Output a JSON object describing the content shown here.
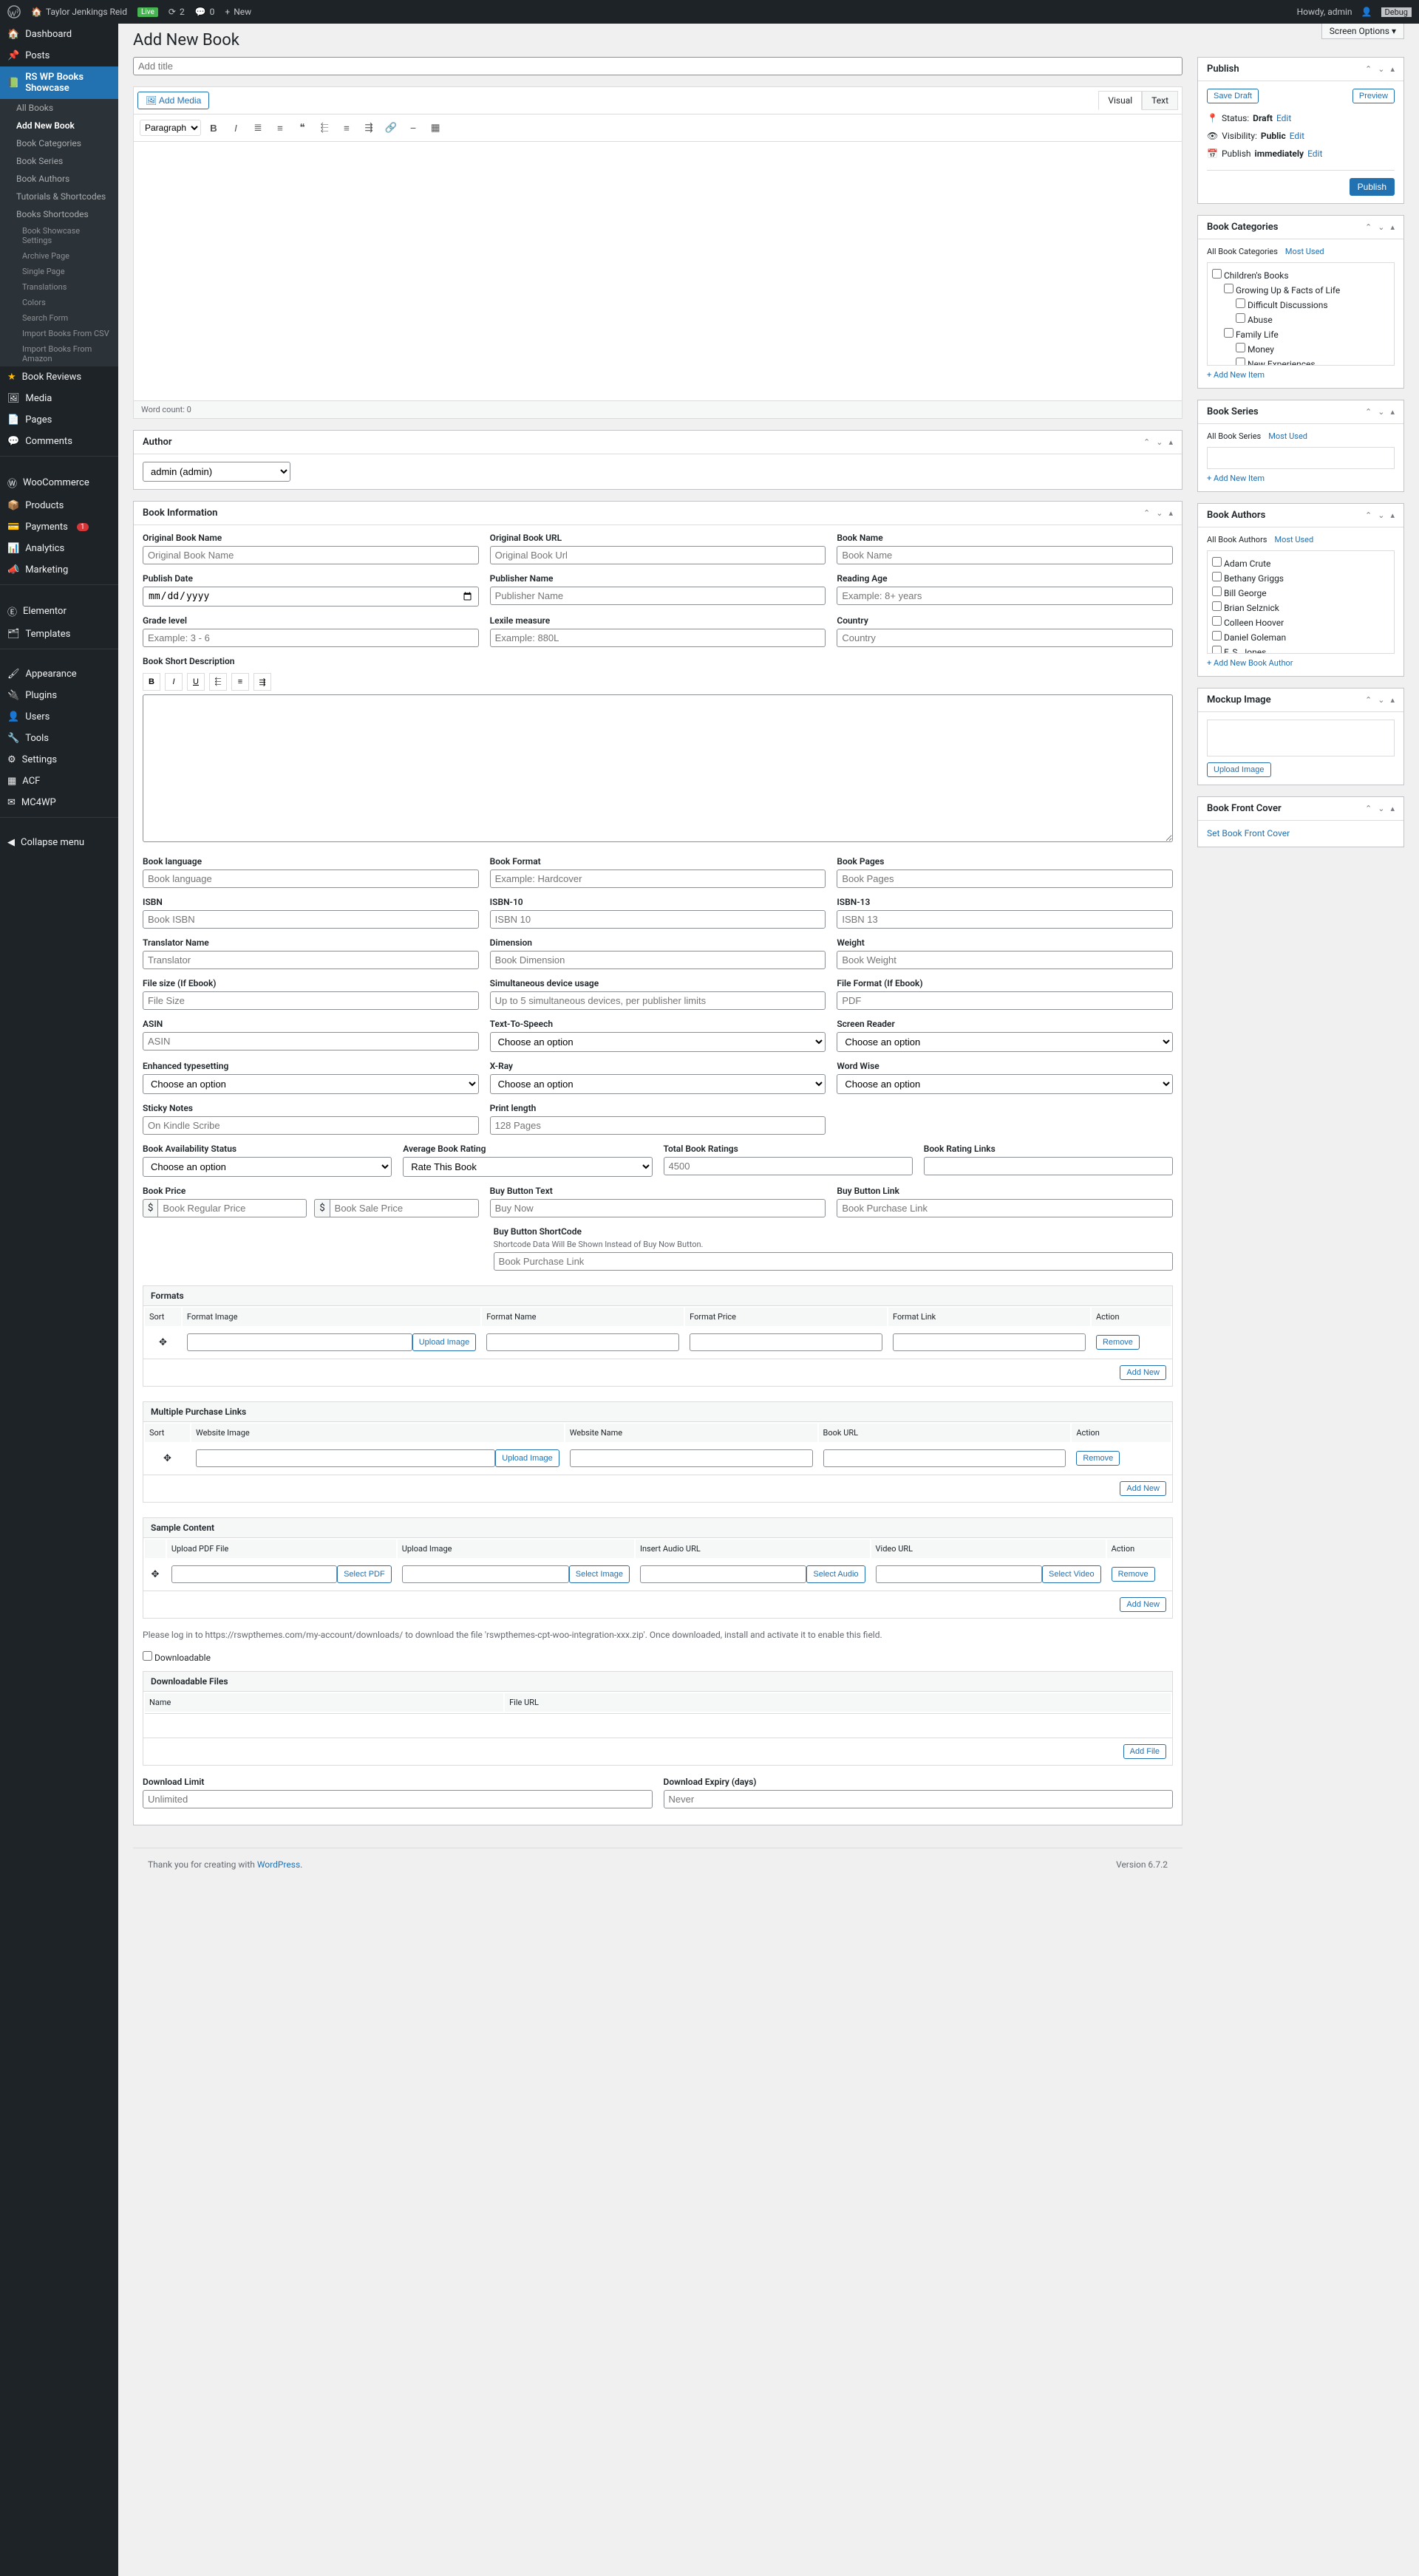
{
  "adminbar": {
    "site": "Taylor Jenkings Reid",
    "live": "Live",
    "updates": "2",
    "comments": "0",
    "new": "New",
    "howdy": "Howdy, admin",
    "debug": "Debug"
  },
  "sidebar": {
    "dashboard": "Dashboard",
    "posts": "Posts",
    "rswp": "RS WP Books Showcase",
    "sub": {
      "all": "All Books",
      "add": "Add New Book",
      "cats": "Book Categories",
      "series": "Book Series",
      "authors": "Book Authors",
      "tuts": "Tutorials & Shortcodes",
      "shortcodes": "Books Shortcodes"
    },
    "subsub": {
      "bss": "Book Showcase Settings",
      "archive": "Archive Page",
      "single": "Single Page",
      "trans": "Translations",
      "colors": "Colors",
      "search": "Search Form",
      "import": "Import Books From CSV",
      "amazon": "Import Books From Amazon"
    },
    "reviews": "Book Reviews",
    "media": "Media",
    "pages": "Pages",
    "comments": "Comments",
    "woo": "WooCommerce",
    "products": "Products",
    "payments": "Payments",
    "payments_badge": "1",
    "analytics": "Analytics",
    "marketing": "Marketing",
    "elementor": "Elementor",
    "templates": "Templates",
    "appearance": "Appearance",
    "plugins": "Plugins",
    "users": "Users",
    "tools": "Tools",
    "settings": "Settings",
    "acf": "ACF",
    "mc4wp": "MC4WP",
    "collapse": "Collapse menu"
  },
  "page": {
    "title": "Add New Book",
    "screen_options": "Screen Options",
    "title_placeholder": "Add title"
  },
  "editor": {
    "add_media": "Add Media",
    "visual": "Visual",
    "text": "Text",
    "paragraph": "Paragraph",
    "wordcount": "Word count: 0"
  },
  "author": {
    "heading": "Author",
    "selected": "admin (admin)"
  },
  "info": {
    "heading": "Book Information",
    "orig_name": {
      "l": "Original Book Name",
      "p": "Original Book Name"
    },
    "orig_url": {
      "l": "Original Book URL",
      "p": "Original Book Url"
    },
    "book_name": {
      "l": "Book Name",
      "p": "Book Name"
    },
    "pub_date": {
      "l": "Publish Date",
      "p": "mm / dd / yyyy"
    },
    "pub_name": {
      "l": "Publisher Name",
      "p": "Publisher Name"
    },
    "reading_age": {
      "l": "Reading Age",
      "p": "Example: 8+ years"
    },
    "grade": {
      "l": "Grade level",
      "p": "Example: 3 - 6"
    },
    "lexile": {
      "l": "Lexile measure",
      "p": "Example: 880L"
    },
    "country": {
      "l": "Country",
      "p": "Country"
    },
    "short_desc": "Book Short Description",
    "lang": {
      "l": "Book language",
      "p": "Book language"
    },
    "format": {
      "l": "Book Format",
      "p": "Example: Hardcover"
    },
    "pages": {
      "l": "Book Pages",
      "p": "Book Pages"
    },
    "isbn": {
      "l": "ISBN",
      "p": "Book ISBN"
    },
    "isbn10": {
      "l": "ISBN-10",
      "p": "ISBN 10"
    },
    "isbn13": {
      "l": "ISBN-13",
      "p": "ISBN 13"
    },
    "translator": {
      "l": "Translator Name",
      "p": "Translator"
    },
    "dimension": {
      "l": "Dimension",
      "p": "Book Dimension"
    },
    "weight": {
      "l": "Weight",
      "p": "Book Weight"
    },
    "filesize": {
      "l": "File size (If Ebook)",
      "p": "File Size"
    },
    "simul": {
      "l": "Simultaneous device usage",
      "p": "Up to 5 simultaneous devices, per publisher limits"
    },
    "fileformat": {
      "l": "File Format (If Ebook)",
      "p": "PDF"
    },
    "asin": {
      "l": "ASIN",
      "p": "ASIN"
    },
    "tts": {
      "l": "Text-To-Speech",
      "p": "Choose an option"
    },
    "screenreader": {
      "l": "Screen Reader",
      "p": "Choose an option"
    },
    "enhanced": {
      "l": "Enhanced typesetting",
      "p": "Choose an option"
    },
    "xray": {
      "l": "X-Ray",
      "p": "Choose an option"
    },
    "wordwise": {
      "l": "Word Wise",
      "p": "Choose an option"
    },
    "sticky": {
      "l": "Sticky Notes",
      "p": "On Kindle Scribe"
    },
    "printlen": {
      "l": "Print length",
      "p": "128 Pages"
    },
    "avail": {
      "l": "Book Availability Status",
      "p": "Choose an option"
    },
    "avgrating": {
      "l": "Average Book Rating",
      "p": "Rate This Book"
    },
    "totalratings": {
      "l": "Total Book Ratings",
      "p": "4500"
    },
    "ratinglinks": {
      "l": "Book Rating Links"
    },
    "price": {
      "l": "Book Price",
      "p1": "Book Regular Price",
      "p2": "Book Sale Price",
      "cur": "$"
    },
    "buytext": {
      "l": "Buy Button Text",
      "p": "Buy Now"
    },
    "buylink": {
      "l": "Buy Button Link",
      "p": "Book Purchase Link"
    },
    "buyshort": {
      "l": "Buy Button ShortCode",
      "note": "Shortcode Data Will Be Shown Instead of Buy Now Button.",
      "p": "Book Purchase Link"
    }
  },
  "formats": {
    "heading": "Formats",
    "sort": "Sort",
    "img": "Format Image",
    "name": "Format Name",
    "price": "Format Price",
    "link": "Format Link",
    "action": "Action",
    "upload": "Upload Image",
    "remove": "Remove",
    "addnew": "Add New"
  },
  "multi": {
    "heading": "Multiple Purchase Links",
    "sort": "Sort",
    "img": "Website Image",
    "name": "Website Name",
    "url": "Book URL",
    "action": "Action",
    "upload": "Upload Image",
    "remove": "Remove",
    "addnew": "Add New"
  },
  "sample": {
    "heading": "Sample Content",
    "pdf": "Upload PDF File",
    "img": "Upload Image",
    "audio": "Insert Audio URL",
    "video": "Video URL",
    "action": "Action",
    "selpdf": "Select PDF",
    "selimg": "Select Image",
    "selaud": "Select Audio",
    "selvid": "Select Video",
    "remove": "Remove",
    "addnew": "Add New"
  },
  "down": {
    "note": "Please log in to https://rswpthemes.com/my-account/downloads/ to download the file 'rswpthemes-cpt-woo-integration-xxx.zip'. Once downloaded, install and activate it to enable this field.",
    "checkbox": "Downloadable",
    "files": "Downloadable Files",
    "name": "Name",
    "url": "File URL",
    "addfile": "Add File",
    "limit": {
      "l": "Download Limit",
      "p": "Unlimited"
    },
    "expiry": {
      "l": "Download Expiry (days)",
      "p": "Never"
    }
  },
  "publish": {
    "heading": "Publish",
    "savedraft": "Save Draft",
    "preview": "Preview",
    "status_l": "Status:",
    "status_v": "Draft",
    "edit": "Edit",
    "visibility_l": "Visibility:",
    "visibility_v": "Public",
    "publish_l": "Publish",
    "publish_v": "immediately",
    "btn": "Publish"
  },
  "cats": {
    "heading": "Book Categories",
    "all": "All Book Categories",
    "most": "Most Used",
    "items": [
      "Children's Books",
      "Growing Up & Facts of Life",
      "Difficult Discussions",
      "Abuse",
      "Family Life",
      "Money",
      "New Experiences"
    ],
    "add": "+ Add New Item"
  },
  "series": {
    "heading": "Book Series",
    "all": "All Book Series",
    "most": "Most Used",
    "add": "+ Add New Item"
  },
  "authors": {
    "heading": "Book Authors",
    "all": "All Book Authors",
    "most": "Most Used",
    "items": [
      "Adam Crute",
      "Bethany Griggs",
      "Bill George",
      "Brian Selznick",
      "Colleen Hoover",
      "Daniel Goleman",
      "F. S. Jones"
    ],
    "add": "+ Add New Book Author"
  },
  "mockup": {
    "heading": "Mockup Image",
    "upload": "Upload Image"
  },
  "front": {
    "heading": "Book Front Cover",
    "set": "Set Book Front Cover"
  },
  "footer": {
    "thanks": "Thank you for creating with ",
    "wp": "WordPress",
    "dot": ".",
    "ver": "Version 6.7.2"
  }
}
